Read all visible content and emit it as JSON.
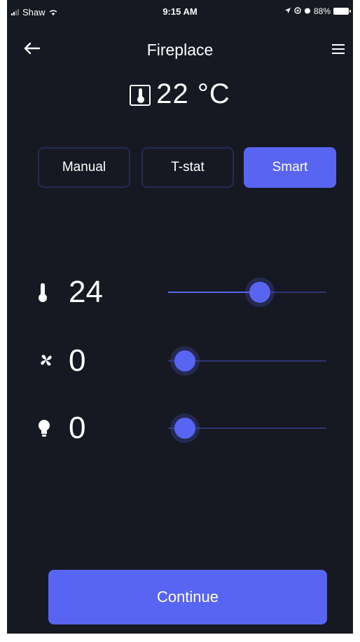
{
  "status_bar": {
    "carrier": "Shaw",
    "time": "9:15 AM",
    "battery": "88%"
  },
  "header": {
    "title": "Fireplace",
    "back_icon": "arrow-left-icon",
    "menu_icon": "hamburger-menu-icon"
  },
  "current_temperature": {
    "icon": "thermometer-box-icon",
    "value": "22 °C"
  },
  "modes": {
    "items": [
      {
        "label": "Manual",
        "selected": false
      },
      {
        "label": "T-stat",
        "selected": false
      },
      {
        "label": "Smart",
        "selected": true
      }
    ]
  },
  "controls": {
    "temperature": {
      "icon": "thermometer-icon",
      "value": "24",
      "level": 0.62
    },
    "fan": {
      "icon": "fan-icon",
      "value": "0",
      "level": 0.0
    },
    "light": {
      "icon": "light-bulb-icon",
      "value": "0",
      "level": 0.0
    }
  },
  "continue_label": "Continue",
  "colors": {
    "background": "#161922",
    "accent": "#5865f2",
    "tab_border": "#232b55"
  }
}
